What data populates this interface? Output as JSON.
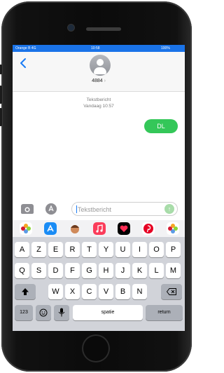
{
  "status_bar": {
    "carrier": "Orange B 4G",
    "time": "10:58",
    "battery": "100%"
  },
  "header": {
    "back_icon": "chevron-left-icon",
    "contact": "4884",
    "contact_chevron": "›"
  },
  "conversation": {
    "service": "Tekstbericht",
    "date": "Vandaag 10:57",
    "messages": [
      {
        "from": "me",
        "text": "DL",
        "color": "#34c759"
      }
    ]
  },
  "compose": {
    "placeholder": "Tekstbericht",
    "send_icon": "↑"
  },
  "app_drawer": [
    {
      "name": "photos-app-icon",
      "color": "#ffffff"
    },
    {
      "name": "app-store-icon",
      "color": "#1a8cf5"
    },
    {
      "name": "memoji-icon",
      "color": "#7a4a2a"
    },
    {
      "name": "music-icon",
      "color": "#fb3c5a"
    },
    {
      "name": "digital-touch-icon",
      "color": "#000000"
    },
    {
      "name": "pinterest-icon",
      "color": "#e60023"
    },
    {
      "name": "photos-app-icon-2",
      "color": "#ffffff"
    }
  ],
  "keyboard": {
    "row1": [
      "A",
      "Z",
      "E",
      "R",
      "T",
      "Y",
      "U",
      "I",
      "O",
      "P"
    ],
    "row2": [
      "Q",
      "S",
      "D",
      "F",
      "G",
      "H",
      "J",
      "K",
      "L",
      "M"
    ],
    "row3": [
      "W",
      "X",
      "C",
      "V",
      "B",
      "N"
    ],
    "numbers": "123",
    "space": "spatie",
    "return": "return",
    "emoji_icon": "emoji-icon",
    "mic_icon": "microphone-icon",
    "shift_icon": "shift-icon",
    "backspace_icon": "backspace-icon"
  }
}
